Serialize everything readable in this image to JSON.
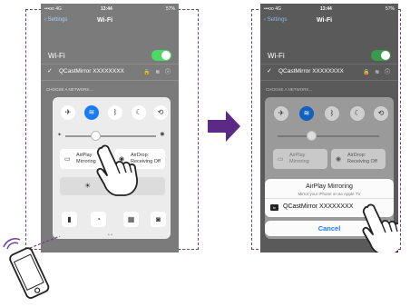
{
  "status": {
    "carrier": "•••oo 4G",
    "time": "13:44",
    "battery": "57%"
  },
  "nav": {
    "back": "Settings",
    "title": "Wi-Fi"
  },
  "wifi": {
    "label": "Wi-Fi",
    "network": "QCastMirror XXXXXXXX",
    "section": "CHOOSE A NETWORK..."
  },
  "control_center": {
    "airplay_line1": "AirPlay",
    "airplay_line2": "Mirroring",
    "airdrop_line1": "AirDrop:",
    "airdrop_line2": "Receiving Off"
  },
  "sheet": {
    "title": "AirPlay Mirroring",
    "subtitle": "Mirror your iPhone on an Apple TV",
    "device": "QCastMirror XXXXXXXX",
    "cancel": "Cancel"
  },
  "colors": {
    "frame": "#6a3d9a",
    "arrow": "#5b2a86",
    "toggle_on": "#4cd964",
    "wifi_active": "#1a7cf5"
  }
}
